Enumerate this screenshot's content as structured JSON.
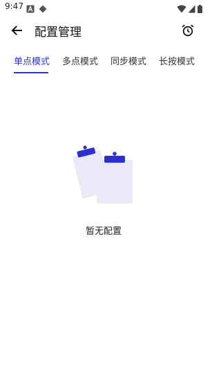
{
  "status_bar": {
    "time": "9:47",
    "icons": [
      "notification-a-icon",
      "diamond-icon",
      "wifi-icon",
      "cellular-signal-icon",
      "battery-icon"
    ]
  },
  "toolbar": {
    "back_icon": "arrow-left-icon",
    "title": "配置管理",
    "action_icon": "alarm-clock-icon"
  },
  "tabs": [
    {
      "label": "单点模式",
      "active": true
    },
    {
      "label": "多点模式",
      "active": false
    },
    {
      "label": "同步模式",
      "active": false
    },
    {
      "label": "长按模式",
      "active": false
    }
  ],
  "empty_state": {
    "icon": "clipboard-icon",
    "message": "暂无配置"
  },
  "colors": {
    "accent": "#2d2fd3",
    "illustration_fill": "#e9e9f8"
  }
}
